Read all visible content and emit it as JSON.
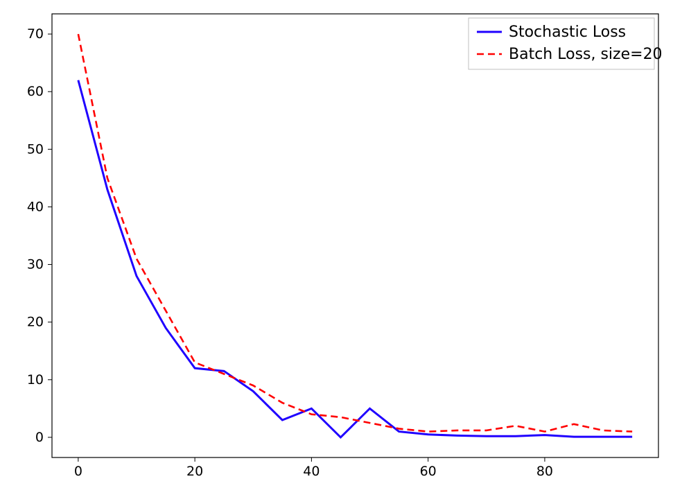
{
  "chart_data": {
    "type": "line",
    "title": "",
    "xlabel": "",
    "ylabel": "",
    "xlim": [
      -4.5,
      99.5
    ],
    "ylim": [
      -3.5,
      73.5
    ],
    "x_ticks": [
      0,
      20,
      40,
      60,
      80
    ],
    "y_ticks": [
      0,
      10,
      20,
      30,
      40,
      50,
      60,
      70
    ],
    "x": [
      0,
      5,
      10,
      15,
      20,
      25,
      30,
      35,
      40,
      45,
      50,
      55,
      60,
      65,
      70,
      75,
      80,
      85,
      90,
      95
    ],
    "series": [
      {
        "name": "Stochastic Loss",
        "color": "#1f00ff",
        "dashed": false,
        "values": [
          62,
          43,
          28,
          19,
          12,
          11.5,
          8,
          3,
          5,
          0,
          5,
          1,
          0.5,
          0.3,
          0.2,
          0.2,
          0.4,
          0.1,
          0.1,
          0.1
        ]
      },
      {
        "name": "Batch Loss, size=20",
        "color": "#ff0000",
        "dashed": true,
        "values": [
          70,
          45,
          31,
          22,
          13,
          11,
          9,
          6,
          4,
          3.5,
          2.5,
          1.5,
          1,
          1.2,
          1.2,
          2,
          1,
          2.3,
          1.2,
          1
        ]
      }
    ],
    "legend": {
      "position": "upper-right",
      "entries": [
        "Stochastic Loss",
        "Batch Loss, size=20"
      ]
    }
  },
  "tick_labels": {
    "x": {
      "0": "0",
      "20": "20",
      "40": "40",
      "60": "60",
      "80": "80"
    },
    "y": {
      "0": "0",
      "10": "10",
      "20": "20",
      "30": "30",
      "40": "40",
      "50": "50",
      "60": "60",
      "70": "70"
    }
  }
}
